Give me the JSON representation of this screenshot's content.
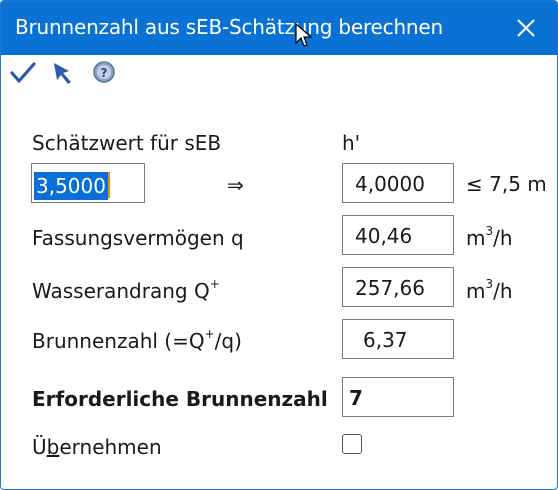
{
  "window": {
    "title": "Brunnenzahl aus sEB-Schätzung berechnen"
  },
  "toolbar": {
    "ok_icon": "checkmark-icon",
    "cancel_icon": "cursor-arrow-icon",
    "help_icon": "help-icon"
  },
  "form": {
    "seb_label": "Schätzwert für sEB",
    "h_label": "h'",
    "seb_value": "3,5000",
    "arrow": "⇒",
    "h_value": "4,0000",
    "h_limit": "≤ 7,5 m",
    "q_label": "Fassungsvermögen q",
    "q_value": "40,46",
    "q_unit_base": "m",
    "q_unit_exp": "3",
    "q_unit_tail": "/h",
    "Q_label_base": "Wasserandrang Q",
    "Q_label_sup": "+",
    "Q_value": "257,66",
    "Q_unit_base": "m",
    "Q_unit_exp": "3",
    "Q_unit_tail": "/h",
    "bz_label_pre": "Brunnenzahl (=Q",
    "bz_label_sup": "+",
    "bz_label_post": "/q)",
    "bz_value": "6,37",
    "req_label": "Erforderliche Brunnenzahl",
    "req_value": "7",
    "adopt_label_pre": "Ü",
    "adopt_label_ul": "b",
    "adopt_label_post": "ernehmen",
    "adopt_checked": false
  },
  "colors": {
    "titlebar": "#0a72d4",
    "selection": "#0a6fd6",
    "caret": "#f08c00"
  }
}
